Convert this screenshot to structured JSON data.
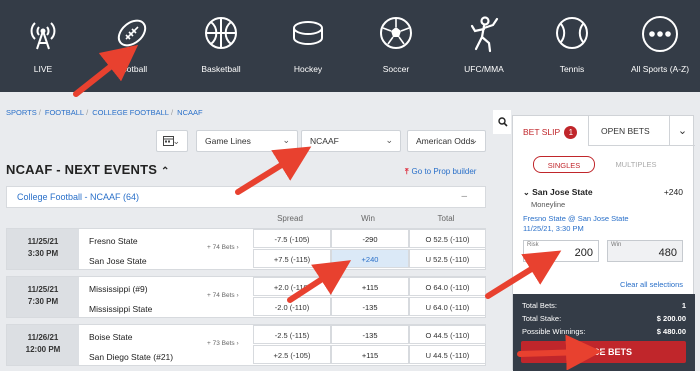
{
  "nav": [
    {
      "label": "LIVE",
      "icon": "live-antenna-icon"
    },
    {
      "label": "Football",
      "icon": "football-icon"
    },
    {
      "label": "Basketball",
      "icon": "basketball-icon"
    },
    {
      "label": "Hockey",
      "icon": "hockey-puck-icon"
    },
    {
      "label": "Soccer",
      "icon": "soccer-ball-icon"
    },
    {
      "label": "UFC/MMA",
      "icon": "fighter-icon"
    },
    {
      "label": "Tennis",
      "icon": "tennis-ball-icon"
    },
    {
      "label": "All Sports (A-Z)",
      "icon": "more-dots-icon"
    }
  ],
  "breadcrumb": [
    "SPORTS",
    "FOOTBALL",
    "COLLEGE FOOTBALL",
    "NCAAF"
  ],
  "filters": {
    "market": "Game Lines",
    "league": "NCAAF",
    "odds_format": "American Odds"
  },
  "page_title": "NCAAF - NEXT EVENTS",
  "prop_builder": "Go to Prop builder",
  "league_header": "College Football - NCAAF (64)",
  "columns": {
    "spread": "Spread",
    "win": "Win",
    "total": "Total"
  },
  "games": [
    {
      "date": "11/25/21",
      "time": "3:30 PM",
      "bets": "+ 74 Bets",
      "teams": [
        {
          "name": "Fresno State",
          "spread": "-7.5 (-105)",
          "win": "-290",
          "total": "O 52.5 (-110)"
        },
        {
          "name": "San Jose State",
          "spread": "+7.5 (-115)",
          "win": "+240",
          "total": "U 52.5 (-110)"
        }
      ]
    },
    {
      "date": "11/25/21",
      "time": "7:30 PM",
      "bets": "+ 74 Bets",
      "teams": [
        {
          "name": "Mississippi (#9)",
          "spread": "+2.0 (-110)",
          "win": "+115",
          "total": "O 64.0 (-110)"
        },
        {
          "name": "Mississippi State",
          "spread": "-2.0 (-110)",
          "win": "-135",
          "total": "U 64.0 (-110)"
        }
      ]
    },
    {
      "date": "11/26/21",
      "time": "12:00 PM",
      "bets": "+ 73 Bets",
      "teams": [
        {
          "name": "Boise State",
          "spread": "-2.5 (-115)",
          "win": "-135",
          "total": "O 44.5 (-110)"
        },
        {
          "name": "San Diego State (#21)",
          "spread": "+2.5 (-105)",
          "win": "+115",
          "total": "U 44.5 (-110)"
        }
      ]
    }
  ],
  "betslip": {
    "tab_label": "BET SLIP",
    "count": "1",
    "open_bets_label": "OPEN BETS",
    "singles": "SINGLES",
    "multiples": "MULTIPLES",
    "pick": "San Jose State",
    "pick_odds": "+240",
    "pick_type": "Moneyline",
    "matchup": "Fresno State @ San Jose State",
    "matchup_date": "11/25/21, 3:30 PM",
    "risk_label": "Risk",
    "risk_value": "200",
    "win_label": "Win",
    "win_value": "480",
    "clear_all": "Clear all selections",
    "total_bets_label": "Total Bets:",
    "total_bets": "1",
    "total_stake_label": "Total Stake:",
    "total_stake": "$ 200.00",
    "possible_label": "Possible Winnings:",
    "possible": "$ 480.00",
    "place_label": "PLACE BETS"
  },
  "colors": {
    "nav_bg": "#343c47",
    "accent_red": "#c0262b",
    "link_blue": "#2a70c9",
    "arrow_red": "#e8412f"
  }
}
